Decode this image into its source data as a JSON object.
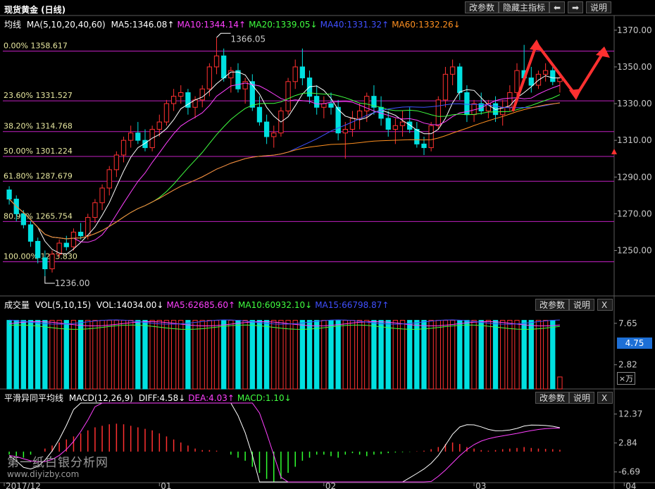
{
  "title_bar": {
    "title": "现货黄金 (日线)",
    "btn_params": "改参数",
    "btn_hide": "隐藏主指标",
    "btn_left": "⬅",
    "btn_right": "➡",
    "btn_help": "说明"
  },
  "main_indicator": {
    "label": "均线",
    "ma_params": "MA(5,10,20,40,60)",
    "items": [
      {
        "text": "MA5:1346.08↑",
        "color": "#ffffff"
      },
      {
        "text": "MA10:1344.14↑",
        "color": "#ff40ff"
      },
      {
        "text": "MA20:1339.05↓",
        "color": "#40ff40"
      },
      {
        "text": "MA40:1331.32↑",
        "color": "#4050ff"
      },
      {
        "text": "MA60:1332.26↓",
        "color": "#ff9020"
      }
    ]
  },
  "vol_indicator": {
    "label": "成交量",
    "params": "VOL(5,10,15)",
    "items": [
      {
        "text": "VOL:14034.00↓",
        "color": "#ffffff"
      },
      {
        "text": "MA5:62685.60↑",
        "color": "#ff40ff"
      },
      {
        "text": "MA10:60932.10↓",
        "color": "#40ff40"
      },
      {
        "text": "MA15:66798.87↑",
        "color": "#4050ff"
      }
    ],
    "btn_params": "改参数",
    "btn_help": "说明",
    "btn_close": "X"
  },
  "macd_indicator": {
    "label": "平滑异同平均线",
    "params": "MACD(12,26,9)",
    "items": [
      {
        "text": "DIFF:4.58↓",
        "color": "#ffffff"
      },
      {
        "text": "DEA:4.03↑",
        "color": "#ff40ff"
      },
      {
        "text": "MACD:1.10↓",
        "color": "#40ff40"
      }
    ],
    "btn_params": "改参数",
    "btn_help": "说明",
    "btn_close": "X"
  },
  "price_axis": {
    "ticks": [
      "1370.00",
      "1350.00",
      "1330.00",
      "1310.00",
      "1290.00",
      "1270.00",
      "1250.00"
    ]
  },
  "vol_axis": {
    "ticks": [
      "7.65",
      "2.82"
    ],
    "badge": "4.75",
    "unit": "×万"
  },
  "macd_axis": {
    "ticks": [
      "12.37",
      "2.84",
      "-6.69"
    ]
  },
  "date_axis": {
    "labels": [
      "2017/12",
      "01",
      "02",
      "03",
      "04"
    ]
  },
  "annotations": {
    "high": "1366.05",
    "low": "1236.00"
  },
  "watermark": {
    "line1": "第一纸白银分析网",
    "line2": "www.diyizby.com"
  },
  "colors": {
    "up": "#ff3030",
    "down": "#00e0e0",
    "fib": "#c020c0",
    "arrow": "#ff3030"
  },
  "chart_data": {
    "type": "candlestick",
    "fib_levels": [
      {
        "label": "0.00% 1358.617",
        "value": 1358.617
      },
      {
        "label": "23.60% 1331.527",
        "value": 1331.527
      },
      {
        "label": "38.20% 1314.768",
        "value": 1314.768
      },
      {
        "label": "50.00% 1301.224",
        "value": 1301.224
      },
      {
        "label": "61.80% 1287.679",
        "value": 1287.679
      },
      {
        "label": "80.90% 1265.754",
        "value": 1265.754
      },
      {
        "label": "100.00% 1243.830",
        "value": 1243.83
      }
    ],
    "ohlc": [
      [
        1283,
        1285,
        1275,
        1278
      ],
      [
        1278,
        1280,
        1266,
        1270
      ],
      [
        1270,
        1272,
        1262,
        1264
      ],
      [
        1264,
        1266,
        1252,
        1255
      ],
      [
        1255,
        1257,
        1243,
        1246
      ],
      [
        1246,
        1250,
        1236,
        1240
      ],
      [
        1240,
        1250,
        1238,
        1248
      ],
      [
        1248,
        1256,
        1246,
        1254
      ],
      [
        1254,
        1258,
        1250,
        1252
      ],
      [
        1252,
        1262,
        1250,
        1260
      ],
      [
        1260,
        1265,
        1256,
        1258
      ],
      [
        1258,
        1270,
        1256,
        1268
      ],
      [
        1268,
        1278,
        1265,
        1276
      ],
      [
        1276,
        1286,
        1272,
        1284
      ],
      [
        1284,
        1296,
        1280,
        1294
      ],
      [
        1294,
        1304,
        1290,
        1302
      ],
      [
        1302,
        1312,
        1298,
        1310
      ],
      [
        1310,
        1318,
        1306,
        1314
      ],
      [
        1314,
        1320,
        1308,
        1310
      ],
      [
        1310,
        1316,
        1304,
        1306
      ],
      [
        1306,
        1318,
        1304,
        1316
      ],
      [
        1316,
        1324,
        1312,
        1320
      ],
      [
        1320,
        1332,
        1318,
        1330
      ],
      [
        1330,
        1338,
        1326,
        1334
      ],
      [
        1334,
        1340,
        1330,
        1336
      ],
      [
        1336,
        1338,
        1324,
        1328
      ],
      [
        1328,
        1334,
        1322,
        1332
      ],
      [
        1332,
        1340,
        1328,
        1338
      ],
      [
        1338,
        1352,
        1334,
        1350
      ],
      [
        1350,
        1366,
        1346,
        1356
      ],
      [
        1356,
        1360,
        1342,
        1344
      ],
      [
        1344,
        1350,
        1336,
        1348
      ],
      [
        1348,
        1352,
        1336,
        1338
      ],
      [
        1338,
        1344,
        1330,
        1342
      ],
      [
        1342,
        1346,
        1326,
        1328
      ],
      [
        1328,
        1334,
        1318,
        1320
      ],
      [
        1320,
        1324,
        1308,
        1312
      ],
      [
        1312,
        1318,
        1306,
        1314
      ],
      [
        1314,
        1328,
        1312,
        1326
      ],
      [
        1326,
        1344,
        1324,
        1342
      ],
      [
        1342,
        1354,
        1338,
        1350
      ],
      [
        1350,
        1360,
        1340,
        1344
      ],
      [
        1344,
        1348,
        1330,
        1334
      ],
      [
        1334,
        1340,
        1324,
        1328
      ],
      [
        1328,
        1334,
        1322,
        1330
      ],
      [
        1330,
        1336,
        1324,
        1328
      ],
      [
        1328,
        1332,
        1310,
        1314
      ],
      [
        1314,
        1320,
        1300,
        1316
      ],
      [
        1316,
        1326,
        1312,
        1322
      ],
      [
        1322,
        1330,
        1316,
        1326
      ],
      [
        1326,
        1336,
        1320,
        1334
      ],
      [
        1334,
        1340,
        1324,
        1328
      ],
      [
        1328,
        1334,
        1318,
        1322
      ],
      [
        1322,
        1326,
        1312,
        1316
      ],
      [
        1316,
        1322,
        1308,
        1318
      ],
      [
        1318,
        1326,
        1312,
        1320
      ],
      [
        1320,
        1328,
        1314,
        1316
      ],
      [
        1316,
        1320,
        1306,
        1308
      ],
      [
        1308,
        1312,
        1302,
        1306
      ],
      [
        1306,
        1320,
        1304,
        1318
      ],
      [
        1318,
        1334,
        1316,
        1332
      ],
      [
        1332,
        1350,
        1328,
        1346
      ],
      [
        1346,
        1354,
        1340,
        1350
      ],
      [
        1350,
        1352,
        1332,
        1336
      ],
      [
        1336,
        1340,
        1320,
        1324
      ],
      [
        1324,
        1332,
        1320,
        1330
      ],
      [
        1330,
        1336,
        1324,
        1326
      ],
      [
        1326,
        1332,
        1322,
        1330
      ],
      [
        1330,
        1334,
        1320,
        1324
      ],
      [
        1324,
        1332,
        1318,
        1328
      ],
      [
        1328,
        1340,
        1326,
        1336
      ],
      [
        1336,
        1352,
        1332,
        1348
      ],
      [
        1348,
        1362,
        1342,
        1344
      ],
      [
        1344,
        1350,
        1336,
        1340
      ],
      [
        1340,
        1348,
        1338,
        1346
      ],
      [
        1346,
        1352,
        1342,
        1348
      ],
      [
        1348,
        1350,
        1340,
        1342
      ],
      [
        1342,
        1346,
        1336,
        1344
      ]
    ],
    "volume": [
      8,
      8,
      8,
      8,
      8,
      8,
      8,
      8,
      8,
      8,
      8,
      8,
      8,
      8,
      8,
      8,
      8,
      8,
      8,
      8,
      8,
      8,
      8,
      8,
      8,
      8,
      8,
      8,
      8,
      8,
      8,
      8,
      8,
      8,
      8,
      8,
      8,
      8,
      8,
      8,
      8,
      8,
      8,
      8,
      8,
      8,
      8,
      8,
      8,
      8,
      8,
      8,
      8,
      8,
      8,
      8,
      8,
      8,
      8,
      8,
      8,
      8,
      8,
      8,
      8,
      8,
      8,
      8,
      8,
      8,
      8,
      8,
      8,
      8,
      8,
      8,
      8,
      1.4
    ],
    "macd_hist": [
      -1,
      -1.5,
      -2,
      -1,
      0,
      1,
      2,
      3,
      4,
      5,
      6,
      7,
      8,
      8.5,
      9,
      9.2,
      9,
      8.5,
      8,
      7.5,
      7,
      6,
      5,
      4,
      3,
      2,
      1,
      0.5,
      0.5,
      0.3,
      0,
      -1,
      -2,
      -3,
      -5,
      -7,
      -9,
      -10,
      -9,
      -7,
      -5,
      -3,
      -2,
      -1,
      -1,
      -1.5,
      -2,
      -1,
      -0.5,
      -1,
      -1.5,
      -1,
      -0.8,
      -0.5,
      -0.3,
      -0.2,
      -0.1,
      0.1,
      0.3,
      0.8,
      1.5,
      2.5,
      3,
      2.5,
      1.5,
      1,
      0.5,
      0.3,
      0.5,
      0.8,
      1,
      1.2,
      1.5,
      1.2,
      1,
      0.9,
      0.8,
      0.6
    ],
    "ylim_price": [
      1226,
      1378
    ],
    "ylim_vol": [
      0,
      9.2
    ],
    "ylim_macd": [
      -10,
      16
    ]
  }
}
